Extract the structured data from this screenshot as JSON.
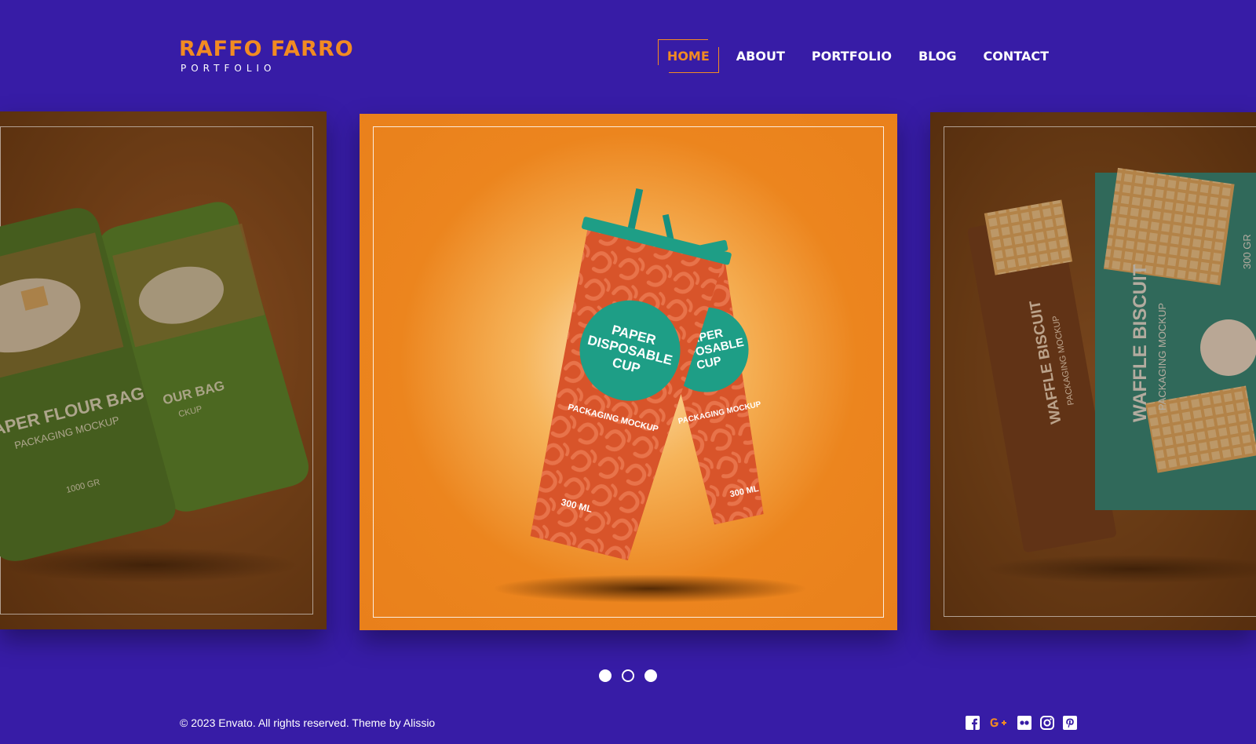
{
  "logo": {
    "title": "RAFFO FARRO",
    "subtitle": "PORTFOLIO"
  },
  "nav": {
    "items": [
      {
        "label": "HOME",
        "active": true
      },
      {
        "label": "ABOUT"
      },
      {
        "label": "PORTFOLIO"
      },
      {
        "label": "BLOG"
      },
      {
        "label": "CONTACT"
      }
    ]
  },
  "slides": {
    "left": {
      "title": "PAPER FLOUR BAG",
      "title_short": "OUR BAG",
      "subtitle": "PACKAGING MOCKUP",
      "subtitle_short": "CKUP",
      "weight": "1000 GR"
    },
    "center": {
      "label_line1": "PAPER",
      "label_line2": "DISPOSABLE",
      "label_line3": "CUP",
      "subtitle": "PACKAGING MOCKUP",
      "volume": "300 ML"
    },
    "right": {
      "title": "WAFFLE BISCUIT",
      "subtitle": "PACKAGING MOCKUP",
      "weight": "300 GR"
    }
  },
  "pager": {
    "count": 3,
    "active_index": 1
  },
  "footer": {
    "copyright": "© 2023 Envato. All rights reserved. Theme by ",
    "author": "Alissio"
  },
  "social": [
    "facebook-icon",
    "google-plus-icon",
    "flickr-icon",
    "instagram-icon",
    "pinterest-icon"
  ],
  "colors": {
    "background": "#371ca6",
    "accent": "#f28b22",
    "cup_red": "#d8542a",
    "cup_teal": "#1e9e86",
    "flour_green": "#3f7a2a",
    "waffle_brown": "#6b3a1e",
    "waffle_teal": "#1f8c86"
  }
}
